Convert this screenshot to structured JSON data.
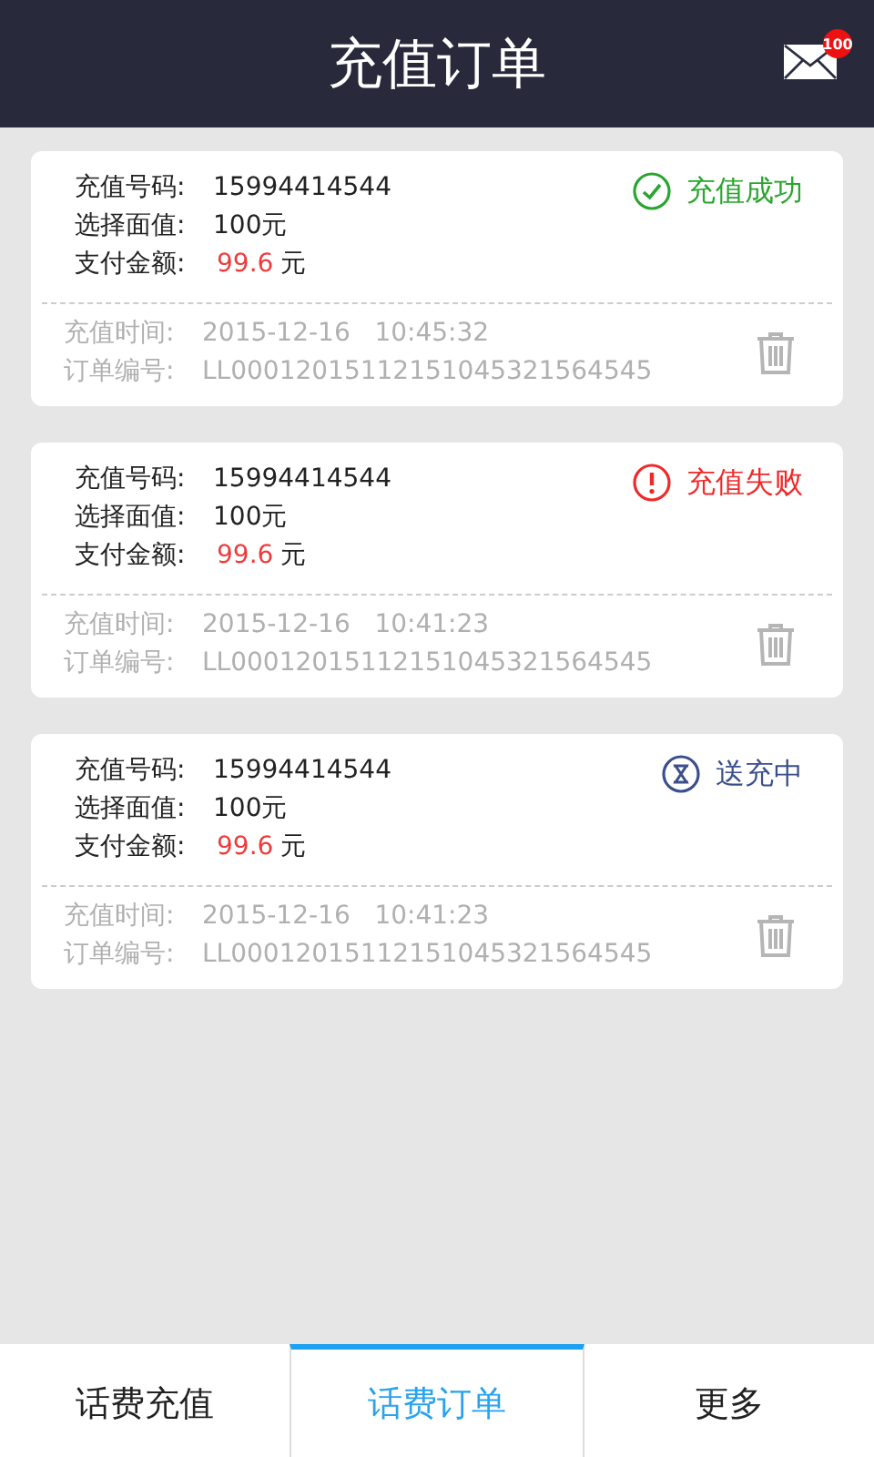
{
  "header": {
    "title": "充值订单",
    "badge": "100"
  },
  "orders": [
    {
      "status": {
        "kind": "success",
        "text": "充值成功"
      },
      "phone_label": "充值号码:",
      "phone": "15994414544",
      "face_label": "选择面值:",
      "face": "100元",
      "pay_label": "支付金额:",
      "amount": "99.6",
      "unit": "元",
      "time_label": "充值时间:",
      "time": "2015-12-16   10:45:32",
      "order_label": "订单编号:",
      "order_no": "LL00012015112151045321564545"
    },
    {
      "status": {
        "kind": "failed",
        "text": "充值失败"
      },
      "phone_label": "充值号码:",
      "phone": "15994414544",
      "face_label": "选择面值:",
      "face": "100元",
      "pay_label": "支付金额:",
      "amount": "99.6",
      "unit": "元",
      "time_label": "充值时间:",
      "time": "2015-12-16   10:41:23",
      "order_label": "订单编号:",
      "order_no": "LL00012015112151045321564545"
    },
    {
      "status": {
        "kind": "pending",
        "text": "送充中"
      },
      "phone_label": "充值号码:",
      "phone": "15994414544",
      "face_label": "选择面值:",
      "face": "100元",
      "pay_label": "支付金额:",
      "amount": "99.6",
      "unit": "元",
      "time_label": "充值时间:",
      "time": "2015-12-16   10:41:23",
      "order_label": "订单编号:",
      "order_no": "LL00012015112151045321564545"
    }
  ],
  "tabs": [
    {
      "label": "话费充值",
      "selected": false
    },
    {
      "label": "话费订单",
      "selected": true
    },
    {
      "label": "更多",
      "selected": false
    }
  ]
}
